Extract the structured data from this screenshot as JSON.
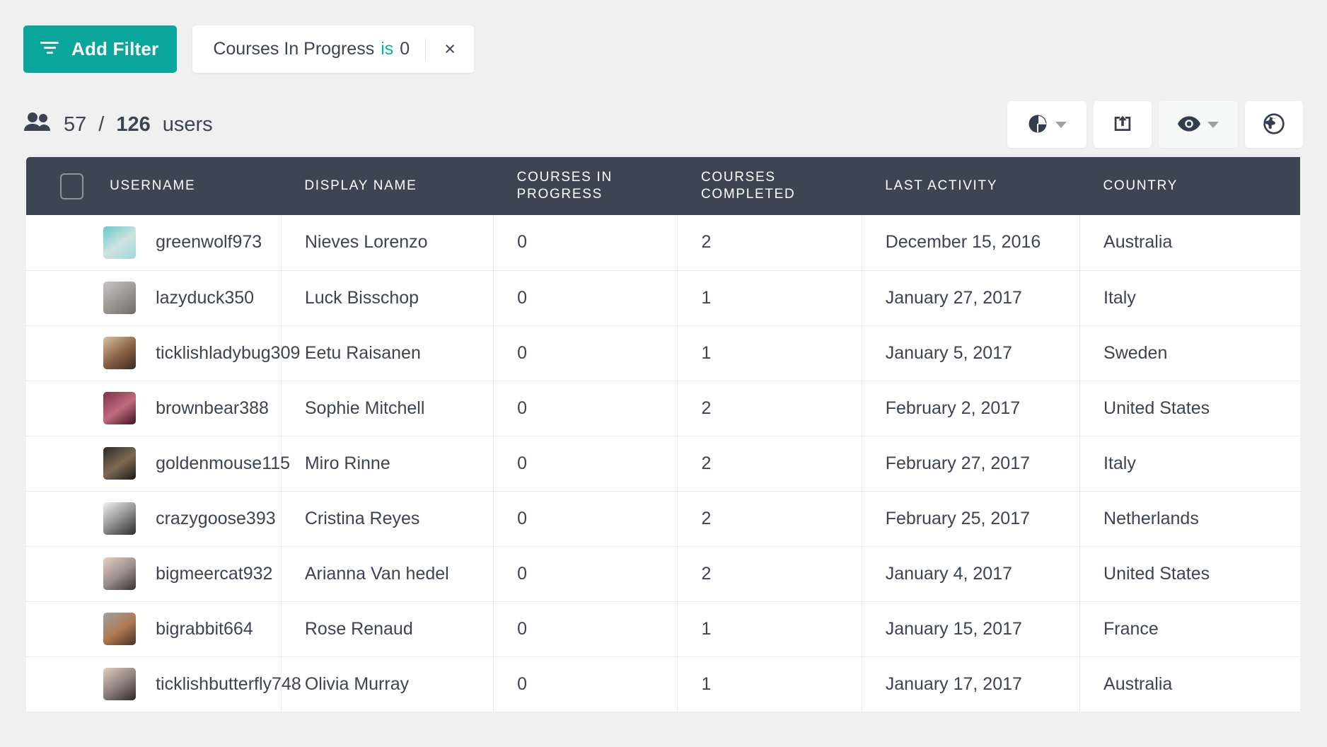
{
  "toolbar_top": {
    "add_filter_label": "Add Filter",
    "filter_icon": "filter-icon",
    "chip": {
      "field": "Courses In Progress",
      "operator": "is",
      "value": "0",
      "close_icon": "×"
    }
  },
  "summary": {
    "people_icon": "people-icon",
    "shown": "57",
    "separator": "/",
    "total": "126",
    "unit": "users"
  },
  "actions": [
    {
      "name": "chart-view-button",
      "icon": "pie-chart-icon",
      "has_caret": true,
      "muted": false
    },
    {
      "name": "export-button",
      "icon": "export-box-icon",
      "has_caret": false,
      "muted": false
    },
    {
      "name": "visibility-button",
      "icon": "eye-icon",
      "has_caret": true,
      "muted": true
    },
    {
      "name": "globe-button",
      "icon": "globe-icon",
      "has_caret": false,
      "muted": false
    }
  ],
  "table": {
    "select_all_checkbox": "select-all-checkbox",
    "columns": [
      "USERNAME",
      "DISPLAY NAME",
      "COURSES IN PROGRESS",
      "COURSES COMPLETED",
      "LAST ACTIVITY",
      "COUNTRY"
    ],
    "rows": [
      {
        "username": "greenwolf973",
        "display_name": "Nieves Lorenzo",
        "courses_in_progress": "0",
        "courses_completed": "2",
        "last_activity": "December 15, 2016",
        "country": "Australia",
        "avatar_colors": [
          "#5fc9cd",
          "#cfe3e0",
          "#9fd6d8"
        ]
      },
      {
        "username": "lazyduck350",
        "display_name": "Luck Bisschop",
        "courses_in_progress": "0",
        "courses_completed": "1",
        "last_activity": "January 27, 2017",
        "country": "Italy",
        "avatar_colors": [
          "#c9c6c2",
          "#9b9894",
          "#6f6c6a"
        ]
      },
      {
        "username": "ticklishladybug309",
        "display_name": "Eetu Raisanen",
        "courses_in_progress": "0",
        "courses_completed": "1",
        "last_activity": "January 5, 2017",
        "country": "Sweden",
        "avatar_colors": [
          "#d8c39f",
          "#8b6246",
          "#3b2a22"
        ]
      },
      {
        "username": "brownbear388",
        "display_name": "Sophie Mitchell",
        "courses_in_progress": "0",
        "courses_completed": "2",
        "last_activity": "February 2, 2017",
        "country": "United States",
        "avatar_colors": [
          "#7c3247",
          "#c2697d",
          "#3a1520"
        ]
      },
      {
        "username": "goldenmouse115",
        "display_name": "Miro Rinne",
        "courses_in_progress": "0",
        "courses_completed": "2",
        "last_activity": "February 27, 2017",
        "country": "Italy",
        "avatar_colors": [
          "#2d2a28",
          "#7d6a52",
          "#1b1a19"
        ]
      },
      {
        "username": "crazygoose393",
        "display_name": "Cristina Reyes",
        "courses_in_progress": "0",
        "courses_completed": "2",
        "last_activity": "February 25, 2017",
        "country": "Netherlands",
        "avatar_colors": [
          "#f2f2f2",
          "#8e8e8e",
          "#2c2c2c"
        ]
      },
      {
        "username": "bigmeercat932",
        "display_name": "Arianna Van hedel",
        "courses_in_progress": "0",
        "courses_completed": "2",
        "last_activity": "January 4, 2017",
        "country": "United States",
        "avatar_colors": [
          "#e8cfc4",
          "#9b8e8c",
          "#3a3230"
        ]
      },
      {
        "username": "bigrabbit664",
        "display_name": "Rose Renaud",
        "courses_in_progress": "0",
        "courses_completed": "1",
        "last_activity": "January 15, 2017",
        "country": "France",
        "avatar_colors": [
          "#9aa2a6",
          "#b07a52",
          "#4a3125"
        ]
      },
      {
        "username": "ticklishbutterfly748",
        "display_name": "Olivia Murray",
        "courses_in_progress": "0",
        "courses_completed": "1",
        "last_activity": "January 17, 2017",
        "country": "Australia",
        "avatar_colors": [
          "#e3cdbe",
          "#8d7f7d",
          "#2f2927"
        ]
      }
    ]
  },
  "colors": {
    "accent": "#0aa69b",
    "chip_operator": "#00b3a4",
    "header_bg": "#3d4552",
    "text": "#3c4452",
    "page_bg": "#f0f0f0"
  }
}
